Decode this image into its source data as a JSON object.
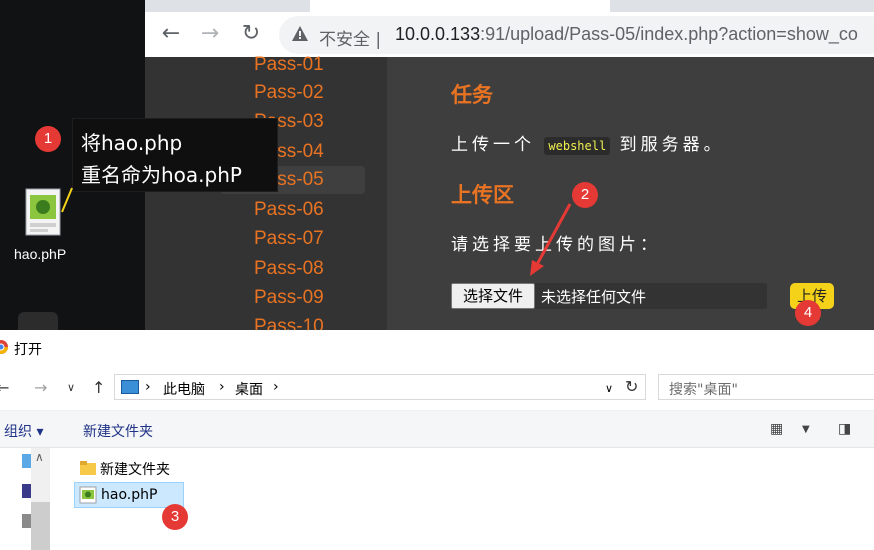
{
  "desktop": {
    "file_name": "hao.phP"
  },
  "browser": {
    "insecure_label": "不安全",
    "url_host": "10.0.0.133",
    "url_port": ":91",
    "url_path": "/upload/Pass-05/index.php?action=show_co"
  },
  "sidebar": {
    "items": [
      "Pass-01",
      "Pass-02",
      "Pass-03",
      "Pass-04",
      "Pass-05",
      "Pass-06",
      "Pass-07",
      "Pass-08",
      "Pass-09",
      "Pass-10"
    ],
    "active_index": 4
  },
  "main": {
    "task_heading": "任务",
    "task_text_prefix": "上传一个",
    "task_code": "webshell",
    "task_text_suffix": "到服务器。",
    "upload_heading": "上传区",
    "choose_prompt": "请选择要上传的图片：",
    "choose_file_button": "选择文件",
    "no_file_text": "未选择任何文件",
    "upload_button": "上传"
  },
  "dialog": {
    "title": "打开",
    "breadcrumb": [
      "此电脑",
      "桌面"
    ],
    "search_placeholder": "搜索\"桌面\"",
    "organize_label": "组织 ▾",
    "new_folder_label": "新建文件夹",
    "items": [
      {
        "name": "新建文件夹",
        "type": "folder"
      },
      {
        "name": "hao.phP",
        "type": "file",
        "selected": true
      }
    ]
  },
  "annotations": {
    "tooltip_line1": "将hao.php",
    "tooltip_line2": "重名命为hoa.phP",
    "badges": [
      "1",
      "2",
      "3",
      "4"
    ]
  },
  "colors": {
    "accent_orange": "#e87322",
    "badge_red": "#e53935",
    "upload_yellow": "#f5d21a",
    "code_yellow": "#f0f050"
  }
}
